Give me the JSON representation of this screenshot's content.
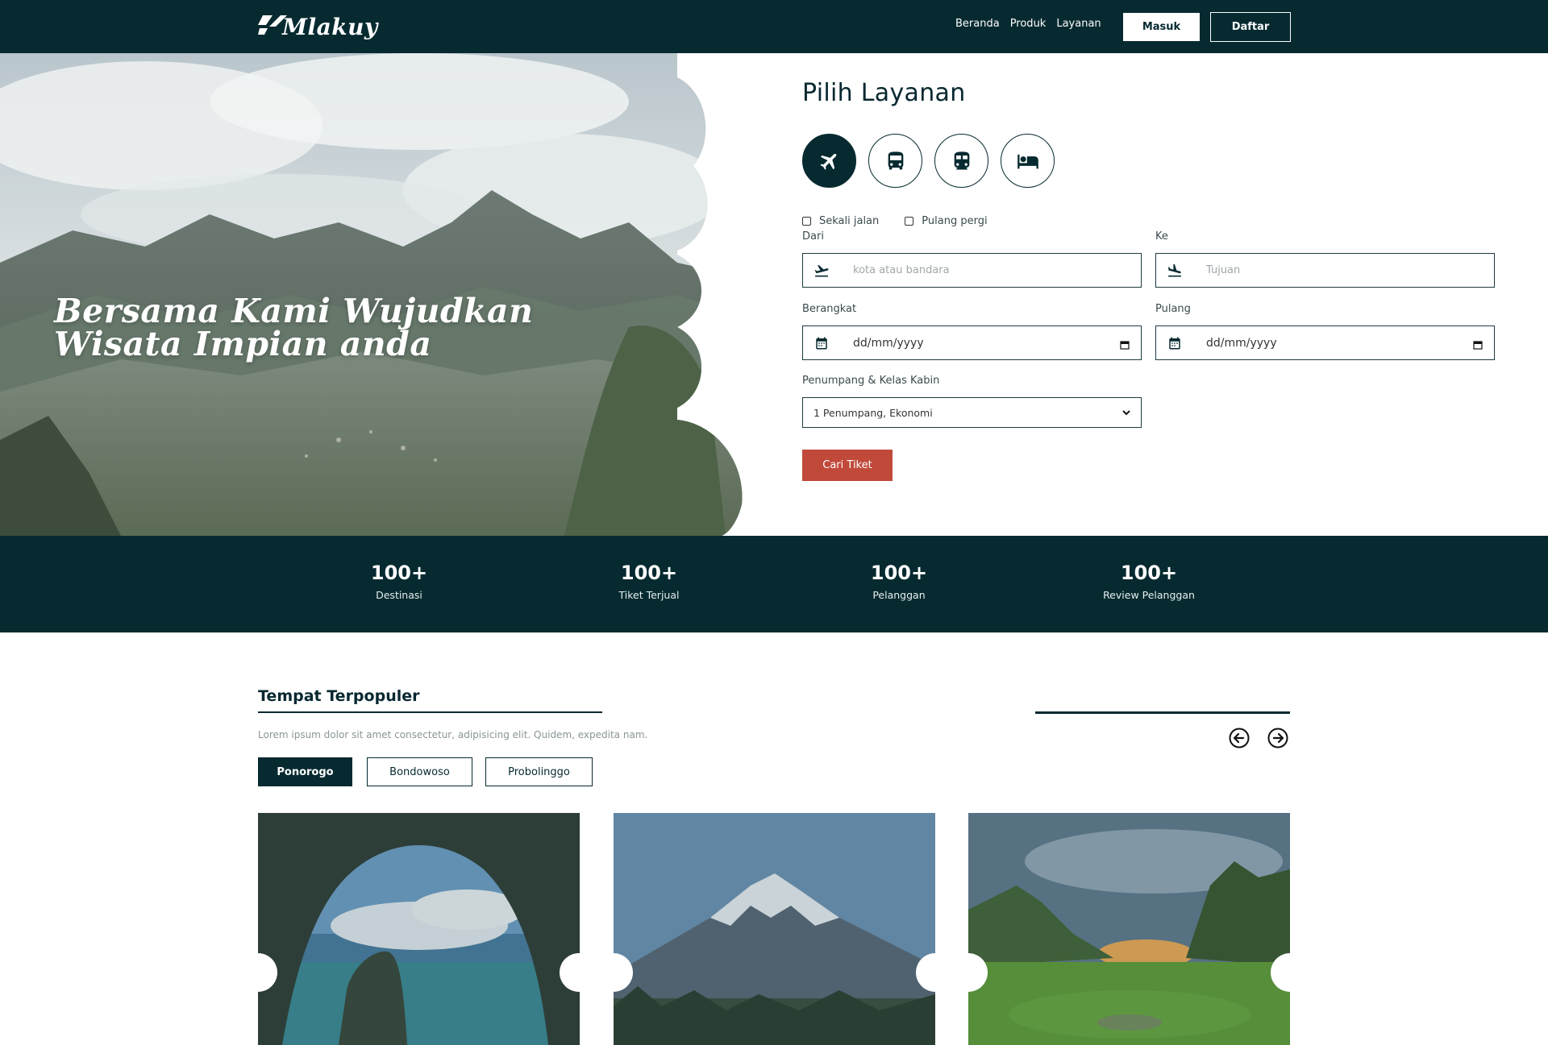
{
  "brand": {
    "name": "Mlakuy"
  },
  "nav": {
    "links": [
      "Beranda",
      "Produk",
      "Layanan"
    ],
    "login_label": "Masuk",
    "register_label": "Daftar"
  },
  "hero": {
    "title_line1": "Bersama Kami Wujudkan",
    "title_line2": "Wisata Impian anda"
  },
  "booking": {
    "title": "Pilih Layanan",
    "services": [
      {
        "icon": "airplane-icon",
        "active": true
      },
      {
        "icon": "bus-icon",
        "active": false
      },
      {
        "icon": "train-icon",
        "active": false
      },
      {
        "icon": "hotel-bed-icon",
        "active": false
      }
    ],
    "trip_types": [
      "Sekali jalan",
      "Pulang pergi"
    ],
    "from_label": "Dari",
    "from_placeholder": "kota atau bandara",
    "to_label": "Ke",
    "to_placeholder": "Tujuan",
    "depart_label": "Berangkat",
    "depart_value": "dd/mm/yyyy",
    "return_label": "Pulang",
    "return_value": "dd/mm/yyyy",
    "passenger_label": "Penumpang & Kelas Kabin",
    "passenger_value": "1 Penumpang, Ekonomi",
    "search_label": "Cari Tiket"
  },
  "stats": [
    {
      "value": "100+",
      "label": "Destinasi"
    },
    {
      "value": "100+",
      "label": "Tiket Terjual"
    },
    {
      "value": "100+",
      "label": "Pelanggan"
    },
    {
      "value": "100+",
      "label": "Review Pelanggan"
    }
  ],
  "popular": {
    "title": "Tempat Terpopuler",
    "description": "Lorem ipsum dolor sit amet consectetur, adipisicing elit. Quidem, expedita nam.",
    "tabs": [
      "Ponorogo",
      "Bondowoso",
      "Probolinggo"
    ],
    "active_tab": "Ponorogo"
  },
  "colors": {
    "primary": "#062a30",
    "accent": "#c0493a",
    "white": "#ffffff"
  }
}
